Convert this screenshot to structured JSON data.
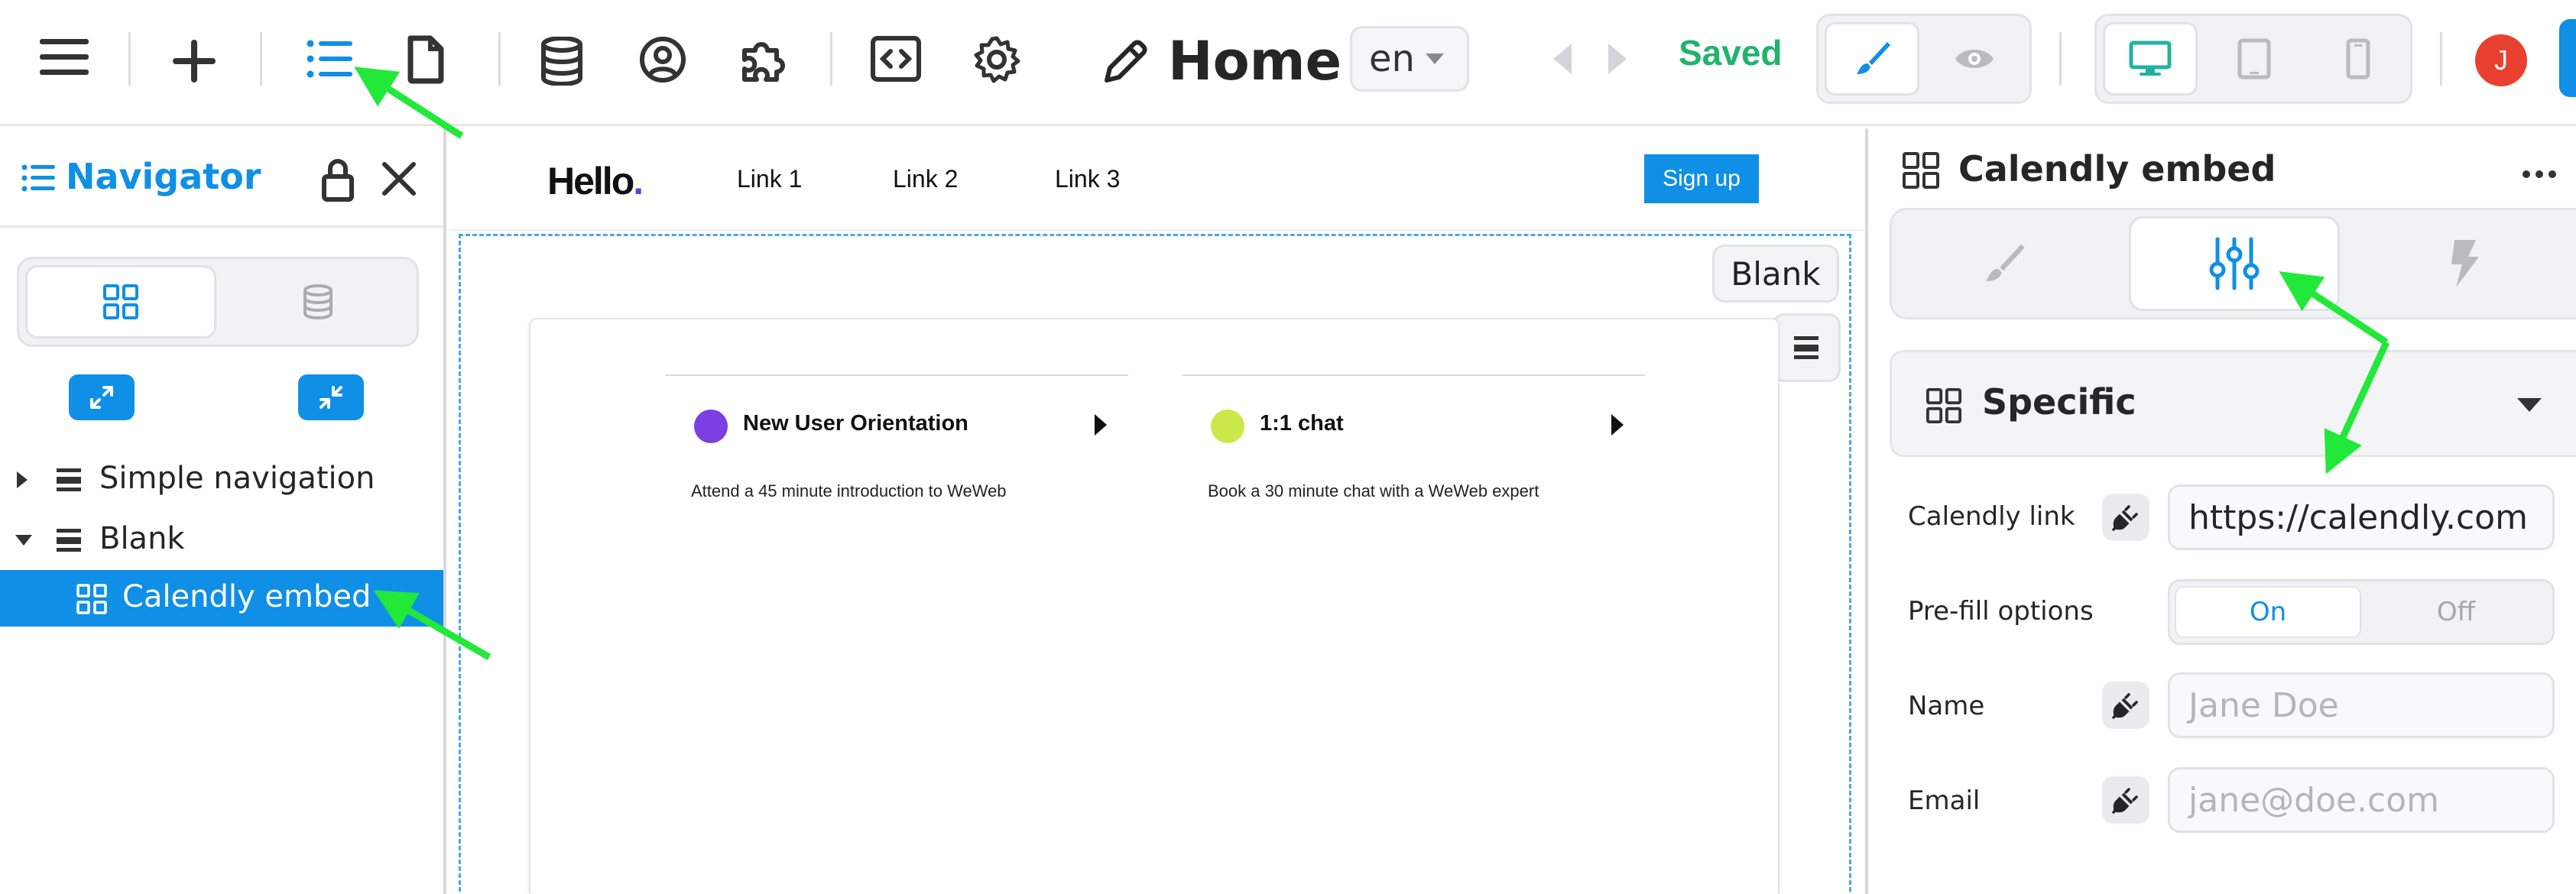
{
  "topbar": {
    "page_title": "Home",
    "language": "en",
    "status": "Saved",
    "avatar_initial": "J"
  },
  "navigator": {
    "title": "Navigator",
    "tree": [
      {
        "label": "Simple navigation",
        "expanded": false,
        "selected": false
      },
      {
        "label": "Blank",
        "expanded": true,
        "selected": false
      },
      {
        "label": "Calendly embed",
        "selected": true
      }
    ]
  },
  "site": {
    "logo": "Hello",
    "logo_dot": ".",
    "links": [
      "Link 1",
      "Link 2",
      "Link 3"
    ],
    "signup": "Sign up",
    "section_label": "Blank",
    "events": [
      {
        "name": "New User Orientation",
        "description": "Attend a 45 minute introduction to WeWeb",
        "color": "#7b3fe4"
      },
      {
        "name": "1:1 chat",
        "description": "Book a 30 minute chat with a WeWeb expert",
        "color": "#cbe84a"
      }
    ]
  },
  "panel": {
    "title": "Calendly embed",
    "section_title": "Specific",
    "properties": {
      "calendly_link_label": "Calendly link",
      "calendly_link_value": "https://calendly.com",
      "prefill_label": "Pre-fill options",
      "prefill_on": "On",
      "prefill_off": "Off",
      "name_label": "Name",
      "name_placeholder": "Jane Doe",
      "email_label": "Email",
      "email_placeholder": "jane@doe.com"
    }
  },
  "colors": {
    "accent": "#0f8fe6",
    "saved": "#21b36d",
    "annotation_arrow": "#22e83a",
    "avatar": "#e8412f"
  }
}
